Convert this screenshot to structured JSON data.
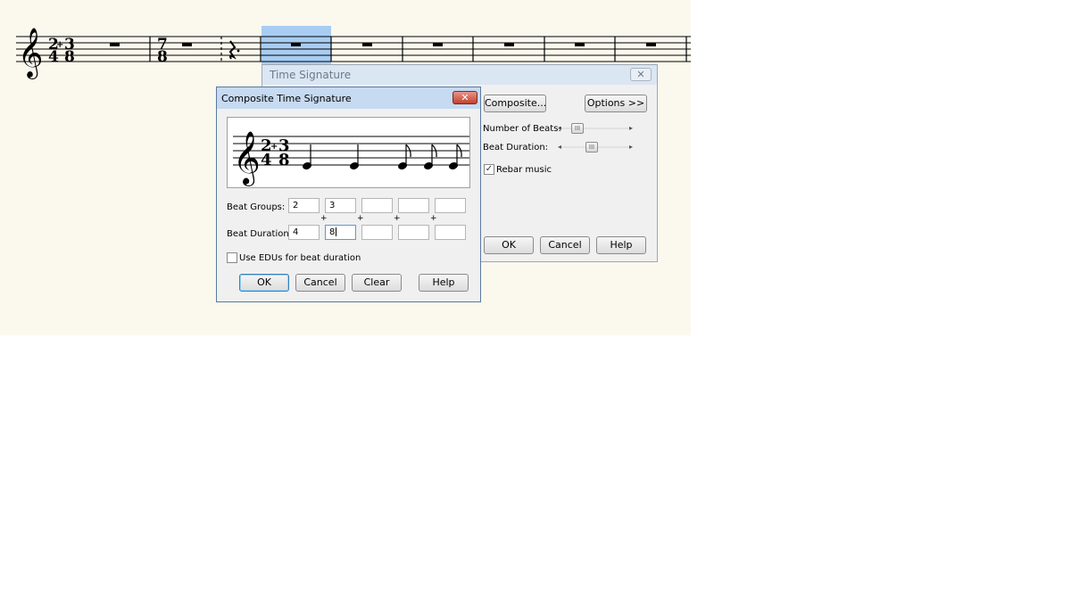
{
  "score": {
    "time_signature_1": {
      "top": "2",
      "top_join": "+",
      "top2": "3",
      "bottom": "4",
      "bottom2": "8"
    },
    "time_signature_2": {
      "top": "7",
      "bottom": "8"
    }
  },
  "time_signature_dialog": {
    "title": "Time Signature",
    "close_label": "✕",
    "composite_button": "Composite...",
    "options_button": "Options >>",
    "number_of_beats_label": "Number of Beats:",
    "beat_duration_label": "Beat Duration:",
    "slider_thumb_glyph": "III",
    "rebar_label": "Rebar music",
    "rebar_checked": true,
    "ok_button": "OK",
    "cancel_button": "Cancel",
    "help_button": "Help"
  },
  "composite_dialog": {
    "title": "Composite Time Signature",
    "close_label": "✕",
    "preview": {
      "top": "2",
      "plus": "+",
      "top2": "3",
      "bottom": "4",
      "bottom2": "8"
    },
    "beat_groups_label": "Beat Groups:",
    "beat_groups": [
      "2",
      "3",
      "",
      "",
      ""
    ],
    "plus_signs": [
      "+",
      "+",
      "+",
      "+"
    ],
    "beat_duration_label": "Beat Duration:",
    "beat_durations": [
      "4",
      "8",
      "",
      "",
      ""
    ],
    "use_edus_label": "Use EDUs for beat duration",
    "use_edus_checked": false,
    "ok_button": "OK",
    "cancel_button": "Cancel",
    "clear_button": "Clear",
    "help_button": "Help"
  }
}
